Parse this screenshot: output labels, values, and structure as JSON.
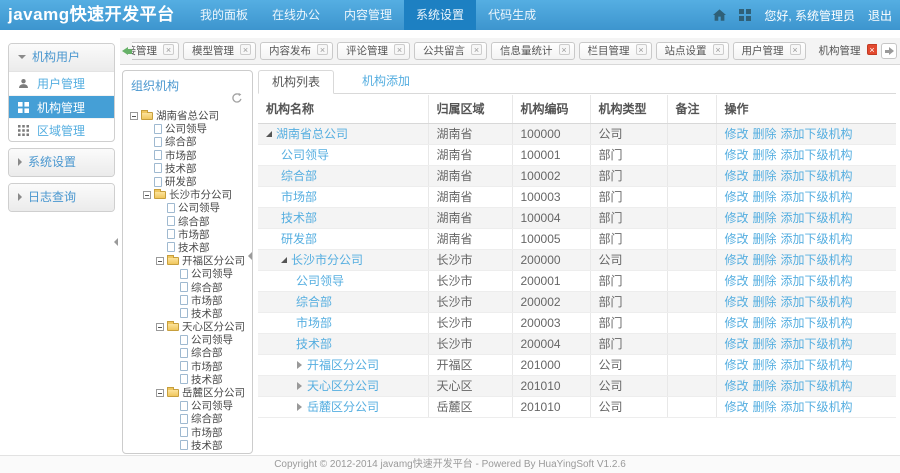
{
  "colors": {
    "header_top": "#55aee2",
    "header_bottom": "#3d95ce",
    "nav_active": "#1d80c2",
    "accent_link": "#55aee0",
    "sidebar_active_bg": "#459fd6",
    "tab_close_active": "#e2492f",
    "row_stripe": "#f4f4f4"
  },
  "header": {
    "logo": "javamg快速开发平台",
    "nav": [
      {
        "key": "my-dashboard",
        "label": "我的面板",
        "active": false
      },
      {
        "key": "online-office",
        "label": "在线办公",
        "active": false
      },
      {
        "key": "content-management",
        "label": "内容管理",
        "active": false
      },
      {
        "key": "system-settings",
        "label": "系统设置",
        "active": true
      },
      {
        "key": "code-generation",
        "label": "代码生成",
        "active": false
      }
    ],
    "greeting": "您好, 系统管理员",
    "logout": "退出"
  },
  "tabbar": {
    "tabs": [
      {
        "key": "link-management",
        "label": "链接管理",
        "active": false
      },
      {
        "key": "model-management",
        "label": "模型管理",
        "active": false
      },
      {
        "key": "content-publish",
        "label": "内容发布",
        "active": false
      },
      {
        "key": "comment-management",
        "label": "评论管理",
        "active": false
      },
      {
        "key": "public-message",
        "label": "公共留言",
        "active": false
      },
      {
        "key": "info-volume-stats",
        "label": "信息量统计",
        "active": false
      },
      {
        "key": "column-management",
        "label": "栏目管理",
        "active": false
      },
      {
        "key": "site-settings",
        "label": "站点设置",
        "active": false
      },
      {
        "key": "user-management",
        "label": "用户管理",
        "active": false
      },
      {
        "key": "org-management",
        "label": "机构管理",
        "active": true
      }
    ]
  },
  "sidebar": {
    "groups": [
      {
        "key": "org-users",
        "label": "机构用户",
        "expanded": true,
        "items": [
          {
            "key": "user-management",
            "label": "用户管理",
            "icon": "user-icon",
            "active": false
          },
          {
            "key": "org-management",
            "label": "机构管理",
            "icon": "org-grid-icon",
            "active": true
          },
          {
            "key": "area-management",
            "label": "区域管理",
            "icon": "area-grid-icon",
            "active": false
          }
        ]
      },
      {
        "key": "system-settings",
        "label": "系统设置",
        "expanded": false,
        "items": []
      },
      {
        "key": "log-query",
        "label": "日志查询",
        "expanded": false,
        "items": []
      }
    ]
  },
  "tree_panel": {
    "title": "组织机构",
    "nodes": [
      {
        "label": "湖南省总公司",
        "level": 0,
        "type": "folder"
      },
      {
        "label": "公司领导",
        "level": 1,
        "type": "file"
      },
      {
        "label": "综合部",
        "level": 1,
        "type": "file"
      },
      {
        "label": "市场部",
        "level": 1,
        "type": "file"
      },
      {
        "label": "技术部",
        "level": 1,
        "type": "file"
      },
      {
        "label": "研发部",
        "level": 1,
        "type": "file"
      },
      {
        "label": "长沙市分公司",
        "level": 1,
        "type": "folder"
      },
      {
        "label": "公司领导",
        "level": 2,
        "type": "file"
      },
      {
        "label": "综合部",
        "level": 2,
        "type": "file"
      },
      {
        "label": "市场部",
        "level": 2,
        "type": "file"
      },
      {
        "label": "技术部",
        "level": 2,
        "type": "file"
      },
      {
        "label": "开福区分公司",
        "level": 2,
        "type": "folder"
      },
      {
        "label": "公司领导",
        "level": 3,
        "type": "file"
      },
      {
        "label": "综合部",
        "level": 3,
        "type": "file"
      },
      {
        "label": "市场部",
        "level": 3,
        "type": "file"
      },
      {
        "label": "技术部",
        "level": 3,
        "type": "file"
      },
      {
        "label": "天心区分公司",
        "level": 2,
        "type": "folder"
      },
      {
        "label": "公司领导",
        "level": 3,
        "type": "file"
      },
      {
        "label": "综合部",
        "level": 3,
        "type": "file"
      },
      {
        "label": "市场部",
        "level": 3,
        "type": "file"
      },
      {
        "label": "技术部",
        "level": 3,
        "type": "file"
      },
      {
        "label": "岳麓区分公司",
        "level": 2,
        "type": "folder"
      },
      {
        "label": "公司领导",
        "level": 3,
        "type": "file"
      },
      {
        "label": "综合部",
        "level": 3,
        "type": "file"
      },
      {
        "label": "市场部",
        "level": 3,
        "type": "file"
      },
      {
        "label": "技术部",
        "level": 3,
        "type": "file"
      }
    ]
  },
  "content": {
    "tabs": [
      {
        "key": "org-list",
        "label": "机构列表",
        "active": true
      },
      {
        "key": "org-add",
        "label": "机构添加",
        "active": false
      }
    ],
    "table": {
      "columns": [
        "机构名称",
        "归属区域",
        "机构编码",
        "机构类型",
        "备注",
        "操作"
      ],
      "op_labels": [
        "修改",
        "删除",
        "添加下级机构"
      ],
      "rows": [
        {
          "name": "湖南省总公司",
          "indent": 0,
          "state": "expanded",
          "region": "湖南省",
          "code": "100000",
          "type": "公司",
          "note": ""
        },
        {
          "name": "公司领导",
          "indent": 1,
          "state": "leaf",
          "region": "湖南省",
          "code": "100001",
          "type": "部门",
          "note": ""
        },
        {
          "name": "综合部",
          "indent": 1,
          "state": "leaf",
          "region": "湖南省",
          "code": "100002",
          "type": "部门",
          "note": ""
        },
        {
          "name": "市场部",
          "indent": 1,
          "state": "leaf",
          "region": "湖南省",
          "code": "100003",
          "type": "部门",
          "note": ""
        },
        {
          "name": "技术部",
          "indent": 1,
          "state": "leaf",
          "region": "湖南省",
          "code": "100004",
          "type": "部门",
          "note": ""
        },
        {
          "name": "研发部",
          "indent": 1,
          "state": "leaf",
          "region": "湖南省",
          "code": "100005",
          "type": "部门",
          "note": ""
        },
        {
          "name": "长沙市分公司",
          "indent": 1,
          "state": "expanded",
          "region": "长沙市",
          "code": "200000",
          "type": "公司",
          "note": ""
        },
        {
          "name": "公司领导",
          "indent": 2,
          "state": "leaf",
          "region": "长沙市",
          "code": "200001",
          "type": "部门",
          "note": ""
        },
        {
          "name": "综合部",
          "indent": 2,
          "state": "leaf",
          "region": "长沙市",
          "code": "200002",
          "type": "部门",
          "note": ""
        },
        {
          "name": "市场部",
          "indent": 2,
          "state": "leaf",
          "region": "长沙市",
          "code": "200003",
          "type": "部门",
          "note": ""
        },
        {
          "name": "技术部",
          "indent": 2,
          "state": "leaf",
          "region": "长沙市",
          "code": "200004",
          "type": "部门",
          "note": ""
        },
        {
          "name": "开福区分公司",
          "indent": 2,
          "state": "collapsed",
          "region": "开福区",
          "code": "201000",
          "type": "公司",
          "note": ""
        },
        {
          "name": "天心区分公司",
          "indent": 2,
          "state": "collapsed",
          "region": "天心区",
          "code": "201010",
          "type": "公司",
          "note": ""
        },
        {
          "name": "岳麓区分公司",
          "indent": 2,
          "state": "collapsed",
          "region": "岳麓区",
          "code": "201010",
          "type": "公司",
          "note": ""
        }
      ]
    }
  },
  "footer": {
    "text": "Copyright © 2012-2014 javamg快速开发平台 - Powered By HuaYingSoft V1.2.6"
  }
}
